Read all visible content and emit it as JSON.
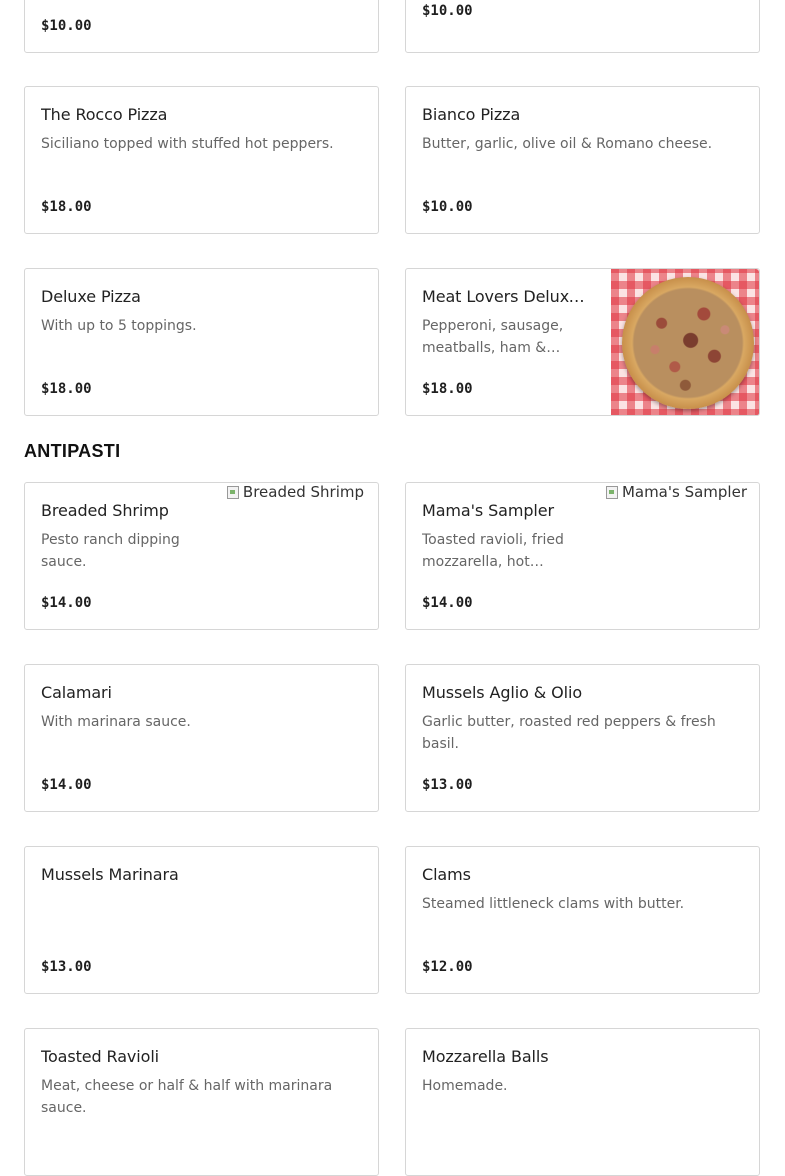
{
  "section": {
    "title": "ANTIPASTI"
  },
  "items": [
    {
      "name": "",
      "description": "",
      "price": "$10.00"
    },
    {
      "name": "",
      "description": "",
      "price": "$10.00"
    },
    {
      "name": "The Rocco Pizza",
      "description": "Siciliano topped with stuffed hot peppers.",
      "price": "$18.00"
    },
    {
      "name": "Bianco Pizza",
      "description": "Butter, garlic, olive oil & Romano cheese.",
      "price": "$10.00"
    },
    {
      "name": "Deluxe Pizza",
      "description": "With up to 5 toppings.",
      "price": "$18.00"
    },
    {
      "name": "Meat Lovers Deluxe…",
      "description": "Pepperoni, sausage, meatballs, ham & bacon.",
      "price": "$18.00",
      "image": "pizza-photo"
    },
    {
      "name": "Breaded Shrimp",
      "description": "Pesto ranch dipping sauce.",
      "price": "$14.00",
      "image_alt": "Breaded Shrimp"
    },
    {
      "name": "Mama's Sampler",
      "description": "Toasted ravioli, fried mozzarella, hot peppers,…",
      "price": "$14.00",
      "image_alt": "Mama's Sampler"
    },
    {
      "name": "Calamari",
      "description": "With marinara sauce.",
      "price": "$14.00"
    },
    {
      "name": "Mussels Aglio & Olio",
      "description": "Garlic butter, roasted red peppers & fresh basil.",
      "price": "$13.00"
    },
    {
      "name": "Mussels Marinara",
      "description": "",
      "price": "$13.00"
    },
    {
      "name": "Clams",
      "description": "Steamed littleneck clams with butter.",
      "price": "$12.00"
    },
    {
      "name": "Toasted Ravioli",
      "description": "Meat, cheese or half & half with marinara sauce.",
      "price": ""
    },
    {
      "name": "Mozzarella Balls",
      "description": "Homemade.",
      "price": ""
    }
  ],
  "colors": {
    "border": "#d6d6d6",
    "text": "#222222",
    "muted": "#666666",
    "checker": "#e03541"
  }
}
